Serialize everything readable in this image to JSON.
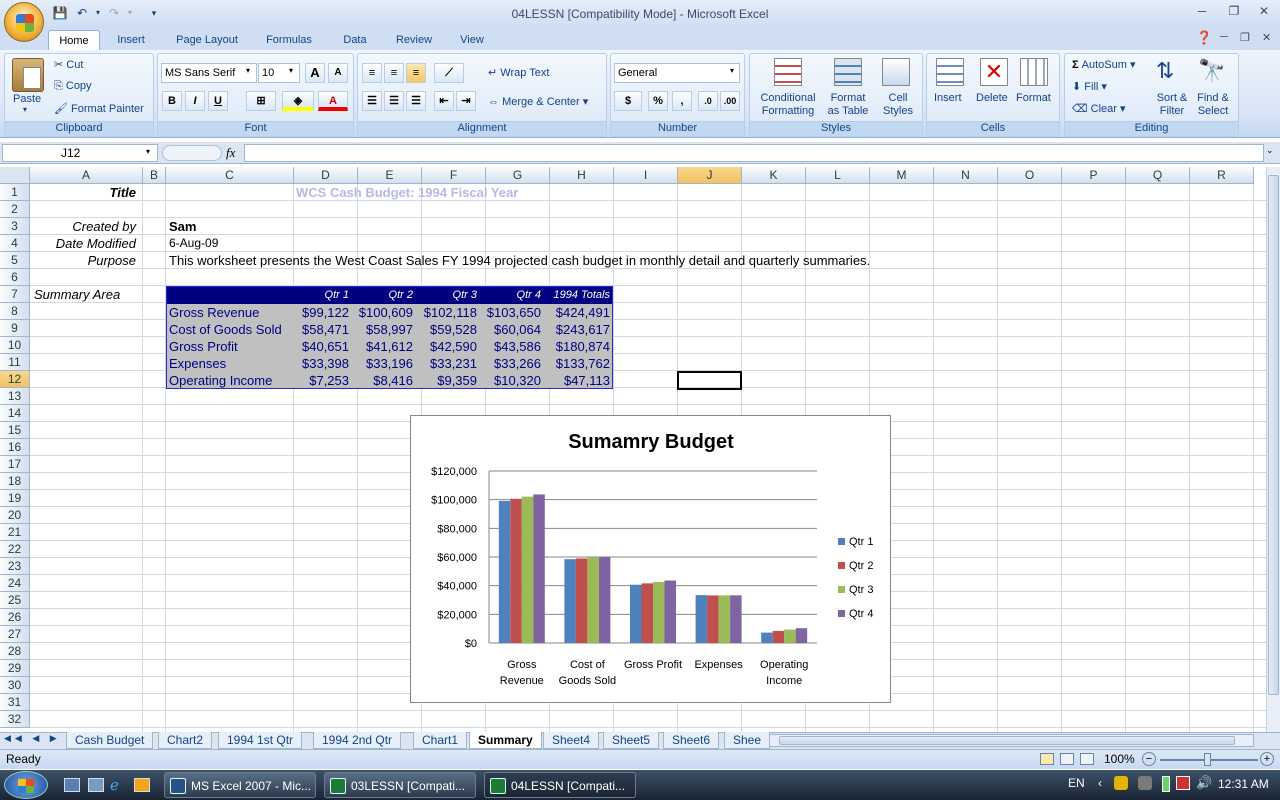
{
  "window": {
    "title": "04LESSN  [Compatibility Mode] - Microsoft Excel"
  },
  "tabs": [
    "Home",
    "Insert",
    "Page Layout",
    "Formulas",
    "Data",
    "Review",
    "View"
  ],
  "ribbon": {
    "clipboard": {
      "label": "Clipboard",
      "paste": "Paste",
      "cut": "Cut",
      "copy": "Copy",
      "format_painter": "Format Painter"
    },
    "font": {
      "label": "Font",
      "family": "MS Sans Serif",
      "size": "10",
      "bold": "B",
      "italic": "I",
      "underline": "U",
      "grow": "A",
      "shrink": "A",
      "color_letter": "A"
    },
    "alignment": {
      "label": "Alignment",
      "wrap": "Wrap Text",
      "merge": "Merge & Center"
    },
    "number": {
      "label": "Number",
      "format": "General",
      "currency": "$",
      "percent": "%",
      "comma": ","
    },
    "styles": {
      "label": "Styles",
      "conditional": "Conditional\nFormatting",
      "format_table": "Format\nas Table",
      "cell_styles": "Cell\nStyles"
    },
    "cells": {
      "label": "Cells",
      "insert": "Insert",
      "delete": "Delete",
      "format": "Format"
    },
    "editing": {
      "label": "Editing",
      "autosum": "AutoSum",
      "fill": "Fill",
      "clear": "Clear",
      "sort": "Sort &\nFilter",
      "find": "Find &\nSelect"
    }
  },
  "formula_bar": {
    "name_box": "J12",
    "fx": "fx",
    "value": ""
  },
  "columns": [
    "A",
    "B",
    "C",
    "D",
    "E",
    "F",
    "G",
    "H",
    "I",
    "J",
    "K",
    "L",
    "M",
    "N",
    "O",
    "P",
    "Q",
    "R"
  ],
  "rows": [
    "1",
    "2",
    "3",
    "4",
    "5",
    "6",
    "7",
    "8",
    "9",
    "10",
    "11",
    "12",
    "13",
    "14",
    "15",
    "16",
    "17",
    "18",
    "19",
    "20",
    "21",
    "22",
    "23",
    "24",
    "25",
    "26",
    "27",
    "28",
    "29",
    "30",
    "31",
    "32"
  ],
  "cells": {
    "a1": "Title",
    "d1": "WCS Cash Budget: 1994 Fiscal Year",
    "a3": "Created by",
    "c3": "Sam",
    "a4": "Date Modified",
    "c4": "6-Aug-09",
    "a5": "Purpose",
    "c5": "This worksheet presents the West Coast Sales FY 1994 projected cash budget in monthly detail and quarterly summaries.",
    "a7": "Summary Area"
  },
  "summary_table": {
    "headers": [
      "Qtr 1",
      "Qtr 2",
      "Qtr 3",
      "Qtr 4",
      "1994 Totals"
    ],
    "rows": [
      {
        "label": "Gross Revenue",
        "values": [
          "$99,122",
          "$100,609",
          "$102,118",
          "$103,650",
          "$424,491"
        ]
      },
      {
        "label": "Cost of Goods Sold",
        "values": [
          "$58,471",
          "$58,997",
          "$59,528",
          "$60,064",
          "$243,617"
        ]
      },
      {
        "label": "Gross Profit",
        "values": [
          "$40,651",
          "$41,612",
          "$42,590",
          "$43,586",
          "$180,874"
        ]
      },
      {
        "label": "Expenses",
        "values": [
          "$33,398",
          "$33,196",
          "$33,231",
          "$33,266",
          "$133,762"
        ]
      },
      {
        "label": "Operating Income",
        "values": [
          "$7,253",
          "$8,416",
          "$9,359",
          "$10,320",
          "$47,113"
        ]
      }
    ]
  },
  "chart_data": {
    "type": "bar",
    "title": "Sumamry Budget",
    "categories": [
      "Gross Revenue",
      "Cost of Goods Sold",
      "Gross Profit",
      "Expenses",
      "Operating Income"
    ],
    "category_lines": [
      [
        "Gross",
        "Revenue"
      ],
      [
        "Cost of",
        "Goods Sold"
      ],
      [
        "Gross Profit"
      ],
      [
        "Expenses"
      ],
      [
        "Operating",
        "Income"
      ]
    ],
    "series": [
      {
        "name": "Qtr 1",
        "color": "#4f81bd",
        "values": [
          99122,
          58471,
          40651,
          33398,
          7253
        ]
      },
      {
        "name": "Qtr 2",
        "color": "#c0504d",
        "values": [
          100609,
          58997,
          41612,
          33196,
          8416
        ]
      },
      {
        "name": "Qtr 3",
        "color": "#9bbb59",
        "values": [
          102118,
          59528,
          42590,
          33231,
          9359
        ]
      },
      {
        "name": "Qtr 4",
        "color": "#8064a2",
        "values": [
          103650,
          60064,
          43586,
          33266,
          10320
        ]
      }
    ],
    "ylim": [
      0,
      120000
    ],
    "yticks": [
      "$0",
      "$20,000",
      "$40,000",
      "$60,000",
      "$80,000",
      "$100,000",
      "$120,000"
    ],
    "legend": "right",
    "grid": true
  },
  "sheets": [
    "Cash Budget",
    "Chart2",
    "1994 1st Qtr",
    "1994 2nd Qtr",
    "Chart1",
    "Summary",
    "Sheet4",
    "Sheet5",
    "Sheet6",
    "Shee"
  ],
  "status": {
    "ready": "Ready",
    "zoom": "100%"
  },
  "taskbar": {
    "items": [
      "MS Excel 2007 - Mic...",
      "03LESSN  [Compati...",
      "04LESSN  [Compati..."
    ],
    "lang": "EN",
    "time": "12:31 AM"
  }
}
